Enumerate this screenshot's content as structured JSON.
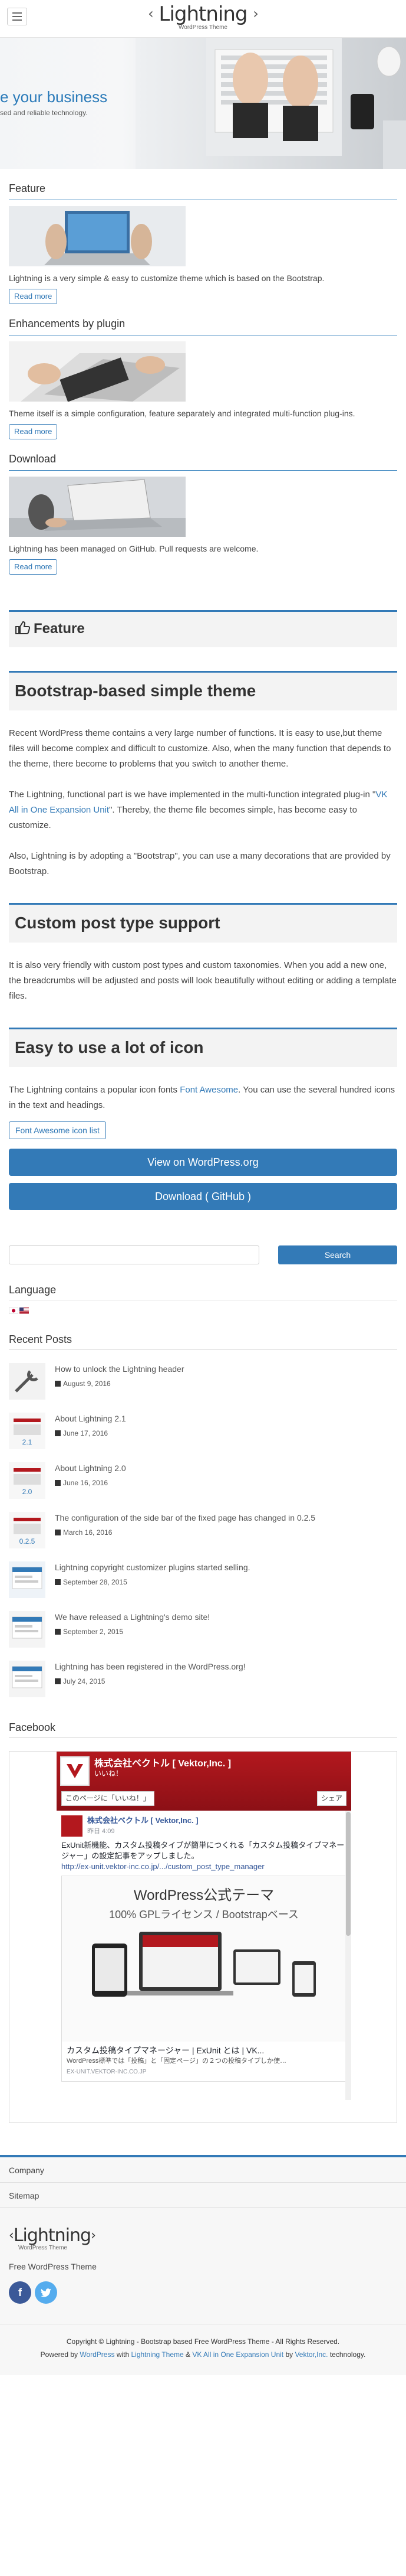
{
  "header": {
    "logo_main": "Lightning",
    "logo_sub": "WordPress Theme",
    "menu_label": "Menu"
  },
  "hero": {
    "title": "e your business",
    "subtitle": "sed and reliable technology."
  },
  "side_features": [
    {
      "heading": "Feature",
      "text": "Lightning is a very simple & easy to customize theme which is based on the Bootstrap.",
      "button": "Read more"
    },
    {
      "heading": "Enhancements by plugin",
      "text": "Theme itself is a simple configuration, feature separately and integrated multi-function plug-ins.",
      "button": "Read more"
    },
    {
      "heading": "Download",
      "text": "Lightning has been managed on GitHub. Pull requests are welcome.",
      "button": "Read more"
    }
  ],
  "feature_section": {
    "title": "Feature"
  },
  "bootstrap_section": {
    "title": "Bootstrap-based simple theme",
    "p1": "Recent WordPress theme contains a very large number of functions. It is easy to use,but theme files will become complex and difficult to customize. Also, when the many function that depends to the theme, there become to problems that you switch to another theme.",
    "p2_a": "The Lightning, functional part is we have implemented in the multi-function integrated plug-in \"",
    "p2_link": "VK All in One Expansion Unit",
    "p2_b": "\". Thereby, the theme file becomes simple, has become easy to customize.",
    "p3": "Also, Lightning is by adopting a \"Bootstrap\", you can use a many decorations that are provided by Bootstrap."
  },
  "custom_post_section": {
    "title": "Custom post type support",
    "p1": "It is also very friendly with custom post types and custom taxonomies. When you add a new one, the breadcrumbs will be adjusted and posts will look beautifully without editing or adding a template files."
  },
  "icon_section": {
    "title": "Easy to use a lot of icon",
    "p1_a": "The Lightning contains a popular icon fonts ",
    "p1_link": "Font Awesome",
    "p1_b": ". You can use the several hundred icons in the text and headings.",
    "list_button": "Font Awesome icon list"
  },
  "cta": {
    "wordpress_button": "View on WordPress.org",
    "github_button": "Download ( GitHub )"
  },
  "search": {
    "placeholder": "",
    "button": "Search"
  },
  "language_widget": {
    "heading": "Language"
  },
  "recent_posts": {
    "heading": "Recent Posts",
    "items": [
      {
        "title": "How to unlock the Lightning header",
        "date": "August 9, 2016"
      },
      {
        "title": "About Lightning 2.1",
        "date": "June 17, 2016"
      },
      {
        "title": "About Lightning 2.0",
        "date": "June 16, 2016"
      },
      {
        "title": "The configuration of the side bar of the fixed page has changed in 0.2.5",
        "date": "March 16, 2016"
      },
      {
        "title": "Lightning copyright customizer plugins started selling.",
        "date": "September 28, 2015"
      },
      {
        "title": "We have released a Lightning's demo site!",
        "date": "September 2, 2015"
      },
      {
        "title": "Lightning has been registered in the WordPress.org!",
        "date": "July 24, 2015"
      }
    ],
    "thumb_labels": [
      "",
      "2.1",
      "2.0",
      "0.2.5",
      "",
      "",
      ""
    ]
  },
  "facebook_widget": {
    "heading": "Facebook",
    "page_name": "株式会社ベクトル [ Vektor,Inc. ]",
    "likes": "いいね！",
    "like_button": "このページに「いいね！」",
    "share_button": "シェア",
    "post_author": "株式会社ベクトル [ Vektor,Inc. ]",
    "post_time": "昨日 4:09",
    "post_text": "ExUnit新機能、カスタム投稿タイプが簡単につくれる「カスタム投稿タイプマネージャー」の設定記事をアップしました。",
    "post_link": "http://ex-unit.vektor-inc.co.jp/.../custom_post_type_manager",
    "card_heading": "WordPress公式テーマ",
    "card_subheading": "100% GPLライセンス / Bootstrapベース",
    "card_title": "カスタム投稿タイプマネージャー | ExUnit とは | VK...",
    "card_desc": "WordPress標準では「投稿」と「固定ページ」の２つの投稿タイプしか使…",
    "card_url": "EX-UNIT.VEKTOR-INC.CO.JP"
  },
  "footer": {
    "menu": [
      "Company",
      "Sitemap"
    ],
    "logo_main": "Lightning",
    "logo_sub": "WordPress Theme",
    "description": "Free WordPress Theme",
    "copyright": "Copyright © Lightning - Bootstrap based Free WordPress Theme - All Rights Reserved.",
    "powered_a": "Powered by ",
    "powered_wp": "WordPress",
    "powered_b": " with ",
    "powered_theme": "Lightning Theme",
    "powered_c": " & ",
    "powered_unit": "VK All in One Expansion Unit",
    "powered_d": " by ",
    "powered_vk": "Vektor,Inc.",
    "powered_e": " technology."
  },
  "colors": {
    "accent": "#337ab7",
    "text": "#464646",
    "facebook": "#3b5998",
    "twitter": "#55acee"
  }
}
